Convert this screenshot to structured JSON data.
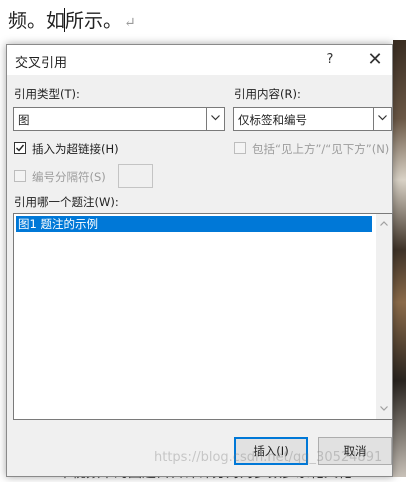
{
  "document": {
    "text": "频。如所示。",
    "return_mark": "↵",
    "bottom_text": "Ｗ中视频中的图题目日计计分对对多数多余化义化"
  },
  "dialog": {
    "title": "交叉引用",
    "help_label": "?",
    "close_label": "✕",
    "reference_type": {
      "label": "引用类型(T):",
      "value": "图"
    },
    "reference_content": {
      "label": "引用内容(R):",
      "value": "仅标签和编号"
    },
    "insert_as_hyperlink": {
      "label": "插入为超链接(H)",
      "checked": true
    },
    "include_above_below": {
      "label": "包括“见上方”/“见下方”(N)",
      "checked": false,
      "enabled": false
    },
    "separate_numbers": {
      "label": "编号分隔符(S)",
      "checked": false,
      "enabled": false
    },
    "which_caption": {
      "label": "引用哪一个题注(W):",
      "items": [
        "图1 题注的示例"
      ],
      "selected_index": 0
    },
    "insert_button": "插入(I)",
    "cancel_button": "取消"
  },
  "watermark": "https://blog.csdn.net/qq_30524891",
  "colors": {
    "selection": "#0078d7",
    "dialog_bg": "#f0f0f0",
    "primary_border": "#0078d7"
  }
}
